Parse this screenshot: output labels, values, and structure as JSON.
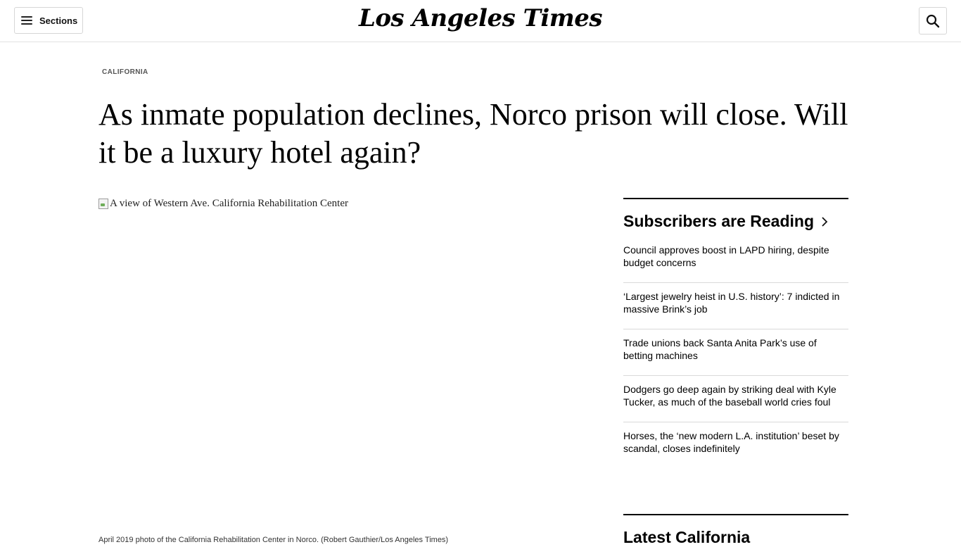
{
  "header": {
    "sections_label": "Sections",
    "logo_text": "Los Angeles Times",
    "search_icon": "search-icon",
    "menu_icon": "hamburger-icon"
  },
  "article": {
    "kicker": "CALIFORNIA",
    "headline": "As inmate population declines, Norco prison will close. Will it be a luxury hotel again?",
    "image_alt": "A view of Western Ave. California Rehabilitation Center",
    "caption": "April 2019 photo of the California Rehabilitation Center in Norco.   (Robert Gauthier/Los Angeles Times)"
  },
  "sidebar": {
    "title": "Subscribers are Reading",
    "stories": [
      "Council approves boost in LAPD hiring, despite budget concerns",
      "‘Largest jewelry heist in U.S. history’: 7 indicted in massive Brink’s job",
      "Trade unions back Santa Anita Park’s use of betting machines",
      "Dodgers go deep again by striking deal with Kyle Tucker, as much of the baseball world cries foul",
      "Horses, the ‘new modern L.A. institution’ beset by scandal, closes indefinitely"
    ],
    "latest_title": "Latest California"
  }
}
